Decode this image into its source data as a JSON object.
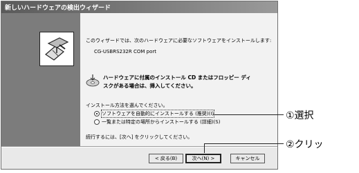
{
  "window": {
    "title": "新しいハードウェアの検出ウィザード"
  },
  "content": {
    "intro": "このウィザードでは、次のハードウェアに必要なソフトウェアをインストールします:",
    "device": "CG-USBRS232R COM port",
    "cd_line1": "ハードウェアに付属のインストール CD またはフロッピー ディ",
    "cd_line2": "スクがある場合は、挿入してください。",
    "method_prompt": "インストール方法を選んでください。",
    "options": [
      {
        "label": "ソフトウェアを自動的にインストールする (推奨)(I)",
        "checked": true
      },
      {
        "label": "一覧または特定の場所からインストールする (詳細)(S)",
        "checked": false
      }
    ],
    "next_hint": "続行するには、[次へ] をクリックしてください。"
  },
  "buttons": {
    "back": "< 戻る(B)",
    "next": "次へ(N) >",
    "cancel": "キャンセル"
  },
  "annotations": {
    "step1": "①選択",
    "step2": "②クリッ"
  },
  "icons": {
    "wizard": "hardware-install-icon",
    "cd": "cd-icon"
  }
}
